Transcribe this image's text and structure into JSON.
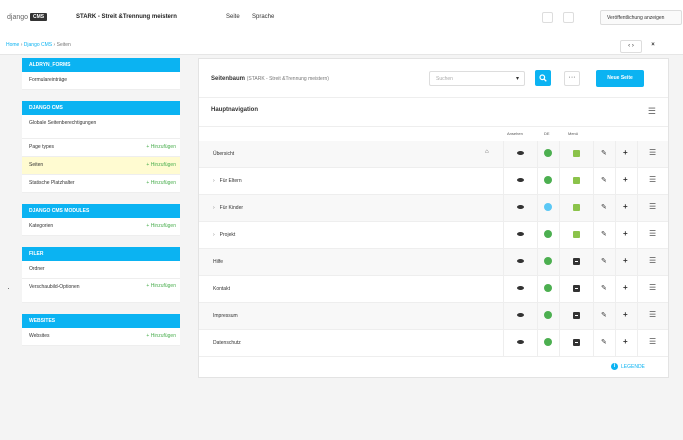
{
  "topbar": {
    "logo_text": "django",
    "logo_badge": "CMS",
    "site_title": "STARK - Streit &Trennung meistern",
    "menu": [
      "Seite",
      "Sprache"
    ],
    "button_label": "Veröffentlichung anzeigen"
  },
  "breadcrumb": {
    "items": [
      "Home",
      "Django CMS",
      "Seiten"
    ],
    "separator": "›"
  },
  "nav": {
    "arrows": "‹ ›",
    "close": "×"
  },
  "sidebar": {
    "add_label": "Hinzufügen",
    "modules": [
      {
        "title": "ALDRYN_FORMS",
        "rows": [
          {
            "label": "Formulareinträge",
            "add": false
          }
        ]
      },
      {
        "title": "DJANGO CMS",
        "rows": [
          {
            "label": "Globale Seitenberechtigungen",
            "add": false,
            "tall": true
          },
          {
            "label": "Page types",
            "add": true
          },
          {
            "label": "Seiten",
            "add": true,
            "active": true
          },
          {
            "label": "Statische Platzhalter",
            "add": true
          }
        ]
      },
      {
        "title": "DJANGO CMS MODULES",
        "rows": [
          {
            "label": "Kategorien",
            "add": true
          }
        ]
      },
      {
        "title": "FILER",
        "rows": [
          {
            "label": "Ordner",
            "add": false
          },
          {
            "label": "Verschaubild-Optionen",
            "add": true,
            "tall": true
          }
        ]
      },
      {
        "title": "WEBSITES",
        "rows": [
          {
            "label": "Websites",
            "add": true
          }
        ]
      }
    ]
  },
  "panel": {
    "title": "Seitenbaum",
    "subtitle": "(STARK - Streit &Trennung meistern)",
    "search_placeholder": "Suchen",
    "new_page_label": "Neue Seite",
    "more_label": "···",
    "section_title": "Hauptnavigation",
    "columns": {
      "view": "Ansehen",
      "status": "DE",
      "menu": "Menü"
    },
    "rows": [
      {
        "name": "Übersicht",
        "expandable": false,
        "home": true,
        "status": "published",
        "menu": "shown"
      },
      {
        "name": "Für Eltern",
        "expandable": true,
        "home": false,
        "status": "published",
        "menu": "shown"
      },
      {
        "name": "Für Kinder",
        "expandable": true,
        "home": false,
        "status": "draft",
        "menu": "shown"
      },
      {
        "name": "Projekt",
        "expandable": true,
        "home": false,
        "status": "published",
        "menu": "shown"
      },
      {
        "name": "Hilfe",
        "expandable": false,
        "home": false,
        "status": "published",
        "menu": "hidden"
      },
      {
        "name": "Kontakt",
        "expandable": false,
        "home": false,
        "status": "published",
        "menu": "hidden"
      },
      {
        "name": "Impressum",
        "expandable": false,
        "home": false,
        "status": "published",
        "menu": "hidden"
      },
      {
        "name": "Datenschutz",
        "expandable": false,
        "home": false,
        "status": "published",
        "menu": "hidden"
      }
    ],
    "legend_label": "LEGENDE"
  },
  "colors": {
    "accent": "#0bb3f2",
    "published": "#4caf50",
    "draft": "#5bc8f5",
    "menu_shown": "#8bc34a",
    "active_row": "#fffbd1"
  },
  "icons": {
    "row_actions": [
      "eye-icon",
      "status-dot-icon",
      "menu-toggle-icon",
      "pencil-icon",
      "plus-icon",
      "hamburger-icon"
    ]
  }
}
